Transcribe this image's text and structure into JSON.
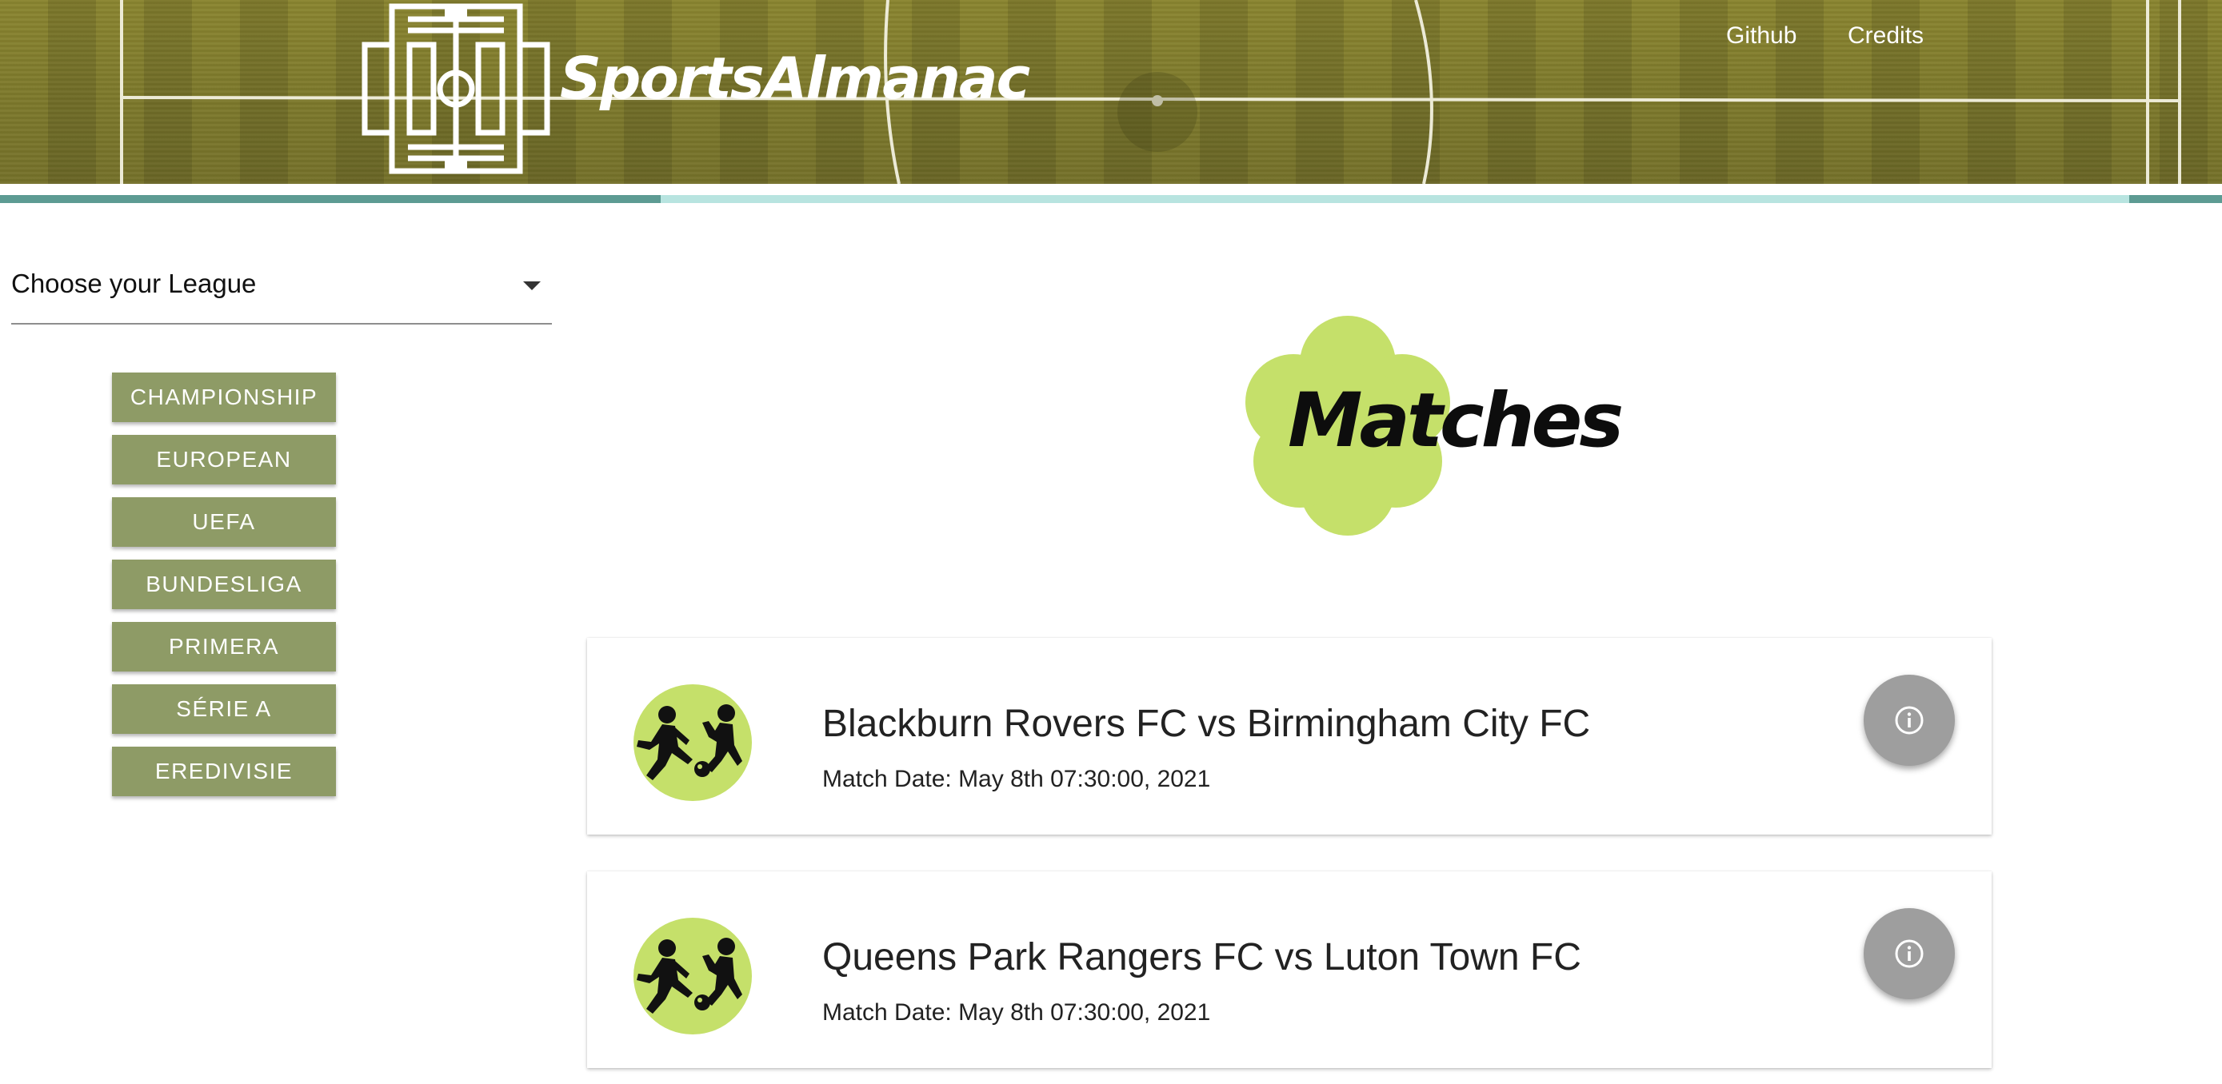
{
  "header": {
    "brand": "SportsAlmanac",
    "nav": {
      "github": "Github",
      "credits": "Credits"
    }
  },
  "progress": {
    "segments": [
      "active-left",
      "active-right"
    ]
  },
  "sidebar": {
    "league_select": {
      "label": "Choose your League",
      "icon": "caret-down-icon"
    },
    "leagues": [
      "CHAMPIONSHIP",
      "EUROPEAN",
      "UEFA",
      "BUNDESLIGA",
      "PRIMERA",
      "SÉRIE A",
      "EREDIVISIE"
    ],
    "button_color": "#8e9b66"
  },
  "main": {
    "heading": "Matches",
    "heading_badge_color": "#c5e06a",
    "matches": [
      {
        "title": "Blackburn Rovers FC vs Birmingham City FC",
        "date": "Match Date: May 8th 07:30:00, 2021",
        "icon": "football-players-icon",
        "action_icon": "info-icon"
      },
      {
        "title": "Queens Park Rangers FC vs Luton Town FC",
        "date": "Match Date: May 8th 07:30:00, 2021",
        "icon": "football-players-icon",
        "action_icon": "info-icon"
      }
    ]
  }
}
